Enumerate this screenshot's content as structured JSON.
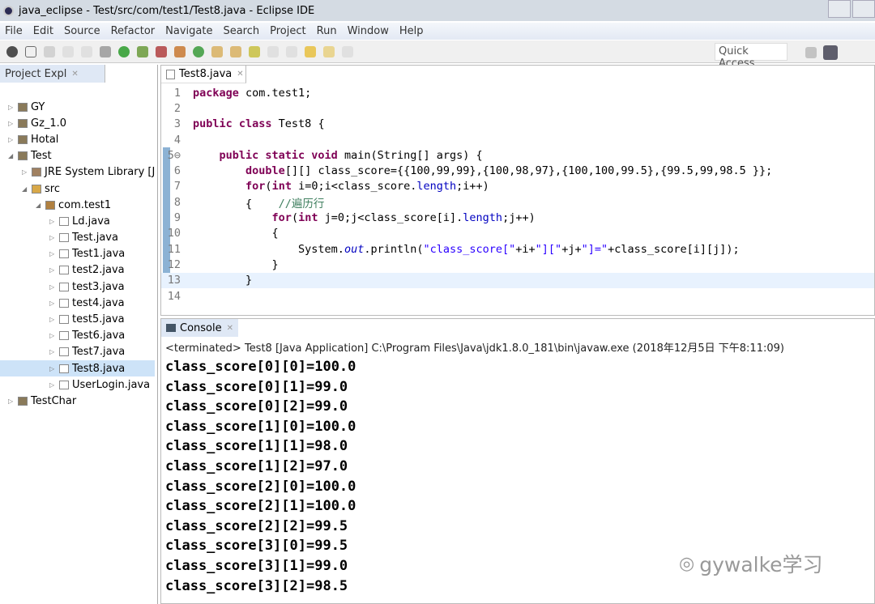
{
  "window": {
    "title": "java_eclipse - Test/src/com/test1/Test8.java - Eclipse IDE"
  },
  "menu": [
    "File",
    "Edit",
    "Source",
    "Refactor",
    "Navigate",
    "Search",
    "Project",
    "Run",
    "Window",
    "Help"
  ],
  "toolbar": {
    "quick_access": "Quick Access"
  },
  "explorer": {
    "tab": "Project Expl",
    "items": [
      {
        "label": "GY",
        "depth": 0,
        "icon": "project",
        "tw": "▷"
      },
      {
        "label": "Gz_1.0",
        "depth": 0,
        "icon": "project",
        "tw": "▷"
      },
      {
        "label": "Hotal",
        "depth": 0,
        "icon": "project",
        "tw": "▷"
      },
      {
        "label": "Test",
        "depth": 0,
        "icon": "project",
        "tw": "◢"
      },
      {
        "label": "JRE System Library [J",
        "depth": 1,
        "icon": "library",
        "tw": "▷"
      },
      {
        "label": "src",
        "depth": 1,
        "icon": "folder",
        "tw": "◢"
      },
      {
        "label": "com.test1",
        "depth": 2,
        "icon": "package",
        "tw": "◢"
      },
      {
        "label": "Ld.java",
        "depth": 3,
        "icon": "java",
        "tw": "▷"
      },
      {
        "label": "Test.java",
        "depth": 3,
        "icon": "java",
        "tw": "▷"
      },
      {
        "label": "Test1.java",
        "depth": 3,
        "icon": "java",
        "tw": "▷"
      },
      {
        "label": "test2.java",
        "depth": 3,
        "icon": "java",
        "tw": "▷"
      },
      {
        "label": "test3.java",
        "depth": 3,
        "icon": "java",
        "tw": "▷"
      },
      {
        "label": "test4.java",
        "depth": 3,
        "icon": "java",
        "tw": "▷"
      },
      {
        "label": "test5.java",
        "depth": 3,
        "icon": "java",
        "tw": "▷"
      },
      {
        "label": "Test6.java",
        "depth": 3,
        "icon": "java",
        "tw": "▷"
      },
      {
        "label": "Test7.java",
        "depth": 3,
        "icon": "java",
        "tw": "▷"
      },
      {
        "label": "Test8.java",
        "depth": 3,
        "icon": "java",
        "tw": "▷",
        "selected": true
      },
      {
        "label": "UserLogin.java",
        "depth": 3,
        "icon": "java",
        "tw": "▷"
      },
      {
        "label": "TestChar",
        "depth": 0,
        "icon": "project",
        "tw": "▷"
      }
    ]
  },
  "editor": {
    "tab": "Test8.java",
    "lines": [
      [
        [
          "package",
          "kw"
        ],
        [
          " com.test1;",
          ""
        ]
      ],
      [],
      [
        [
          "public class",
          "kw"
        ],
        [
          " Test8 {",
          ""
        ]
      ],
      [],
      [
        [
          "    "
        ],
        [
          "public static void",
          "kw"
        ],
        [
          " main(String[] args) {",
          ""
        ]
      ],
      [
        [
          "        "
        ],
        [
          "double",
          "kw"
        ],
        [
          "[][] class_score={{100,99,99},{100,98,97},{100,100,99.5},{99.5,99,98.5 }};",
          ""
        ]
      ],
      [
        [
          "        "
        ],
        [
          "for",
          "kw"
        ],
        [
          "(",
          ""
        ],
        [
          "int",
          "kw"
        ],
        [
          " i=0;i<class_score.",
          ""
        ],
        [
          "length",
          "fd"
        ],
        [
          ";i++)",
          ""
        ]
      ],
      [
        [
          "        {    "
        ],
        [
          "//遍历行",
          "cm"
        ]
      ],
      [
        [
          "            "
        ],
        [
          "for",
          "kw"
        ],
        [
          "(",
          ""
        ],
        [
          "int",
          "kw"
        ],
        [
          " j=0;j<class_score[i].",
          ""
        ],
        [
          "length",
          "fd"
        ],
        [
          ";j++)",
          ""
        ]
      ],
      [
        [
          "            {"
        ]
      ],
      [
        [
          "                System.",
          ""
        ],
        [
          "out",
          "fd it"
        ],
        [
          ".println(",
          ""
        ],
        [
          "\"class_score[\"",
          "st"
        ],
        [
          "+i+",
          ""
        ],
        [
          "\"][\"",
          "st"
        ],
        [
          "+j+",
          ""
        ],
        [
          "\"]=\"",
          "st"
        ],
        [
          "+class_score[i][j]);",
          ""
        ]
      ],
      [
        [
          "            }"
        ]
      ],
      [
        [
          "        }"
        ]
      ],
      []
    ]
  },
  "console": {
    "tab": "Console",
    "info": "<terminated> Test8 [Java Application] C:\\Program Files\\Java\\jdk1.8.0_181\\bin\\javaw.exe (2018年12月5日 下午8:11:09)",
    "output": [
      "class_score[0][0]=100.0",
      "class_score[0][1]=99.0",
      "class_score[0][2]=99.0",
      "class_score[1][0]=100.0",
      "class_score[1][1]=98.0",
      "class_score[1][2]=97.0",
      "class_score[2][0]=100.0",
      "class_score[2][1]=100.0",
      "class_score[2][2]=99.5",
      "class_score[3][0]=99.5",
      "class_score[3][1]=99.0",
      "class_score[3][2]=98.5"
    ]
  },
  "watermark": "gywalke学习"
}
